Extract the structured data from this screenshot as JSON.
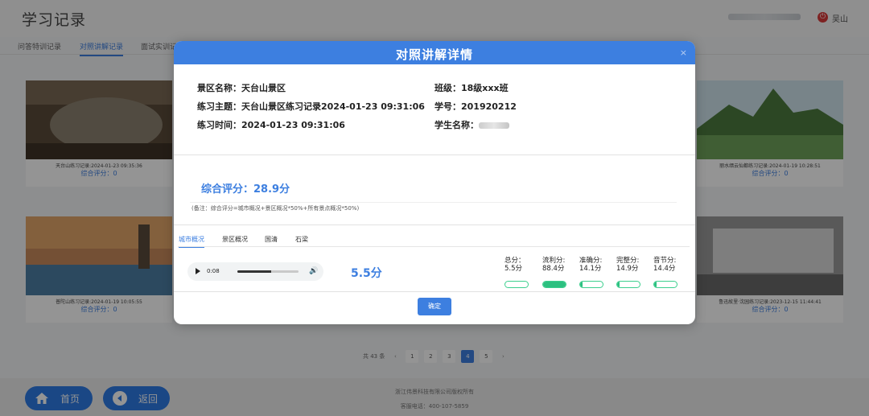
{
  "header": {
    "title": "学习记录",
    "user_name": "吴山"
  },
  "tabs": [
    {
      "label": "问答特训记录"
    },
    {
      "label": "对照讲解记录"
    },
    {
      "label": "面试实训记录"
    }
  ],
  "cards": [
    {
      "caption": "天台山练习记录:2024-01-23 09:35:36",
      "score": "综合评分：0"
    },
    {
      "caption": "丽水缙云仙都练习记录:2024-01-19 10:28:51",
      "score": "综合评分：0"
    },
    {
      "caption": "普陀山练习记录:2024-01-19 10:05:55",
      "score": "综合评分：0"
    },
    {
      "caption": "鲁迅故里·沈园练习记录:2023-12-15 11:44:41",
      "score": "综合评分：0"
    }
  ],
  "pagination": {
    "total": "共 43 条",
    "pages": [
      "1",
      "2",
      "3",
      "4",
      "5"
    ],
    "current": "4",
    "prev": "‹",
    "next": "›"
  },
  "footer": {
    "copyright": "浙江伟景科技有限公司版权所有",
    "phone": "客服电话：400-107-5859"
  },
  "nav": {
    "home": "首页",
    "back": "返回"
  },
  "modal": {
    "title": "对照讲解详情",
    "close": "×",
    "scenic_area": "景区名称：天台山景区",
    "topic": "练习主题：天台山景区练习记录2024-01-23 09:31:06",
    "practice_time": "练习时间：2024-01-23 09:31:06",
    "class": "班级：18级xxx班",
    "student_no": "学号：201920212",
    "student_name_label": "学生名称：",
    "total_score": "综合评分：28.9分",
    "note": "(备注：综合评分=城市概况+景区概况*50%+所有景点概况*50%)",
    "detail_tabs": [
      {
        "label": "城市概况"
      },
      {
        "label": "景区概况"
      },
      {
        "label": "国清"
      },
      {
        "label": "石梁"
      }
    ],
    "audio": {
      "time": "0:08",
      "progress": 0.55
    },
    "segment_score": "5.5分",
    "metrics": [
      {
        "label": "总分：5.5分",
        "value": 0.0
      },
      {
        "label": "流利分:88.4分",
        "value": 1.0
      },
      {
        "label": "准确分:14.1分",
        "value": 0.12
      },
      {
        "label": "完整分:14.9分",
        "value": 0.12
      },
      {
        "label": "音节分:14.4分",
        "value": 0.12
      }
    ],
    "confirm": "确定"
  }
}
